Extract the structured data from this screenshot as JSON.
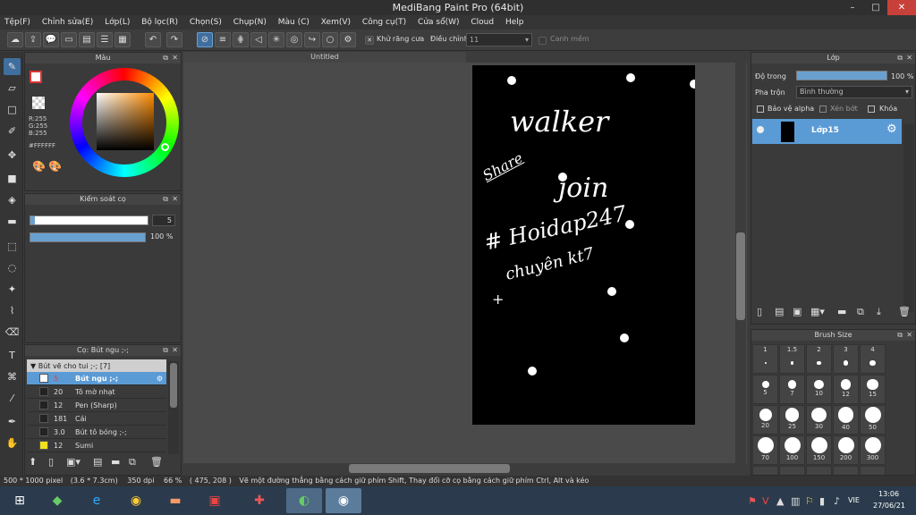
{
  "window": {
    "title": "MediBang Paint Pro (64bit)",
    "minimize": "–",
    "maximize": "□",
    "close": "✕"
  },
  "menu": [
    "Tệp(F)",
    "Chỉnh sửa(E)",
    "Lớp(L)",
    "Bộ lọc(R)",
    "Chọn(S)",
    "Chụp(N)",
    "Màu (C)",
    "Xem(V)",
    "Công cụ(T)",
    "Cửa sổ(W)",
    "Cloud",
    "Help"
  ],
  "toolbar": {
    "antialias_label": "Khử răng cưa",
    "adjust_label": "Điều chỉnh",
    "adjust_value": "11",
    "smooth_label": "Canh mềm"
  },
  "doc_tab": "Untitled",
  "color_panel": {
    "title": "Màu",
    "r": "R:255",
    "g": "G:255",
    "b": "B:255",
    "hex": "#FFFFFF"
  },
  "brush_control": {
    "title": "Kiểm soát cọ",
    "size": "5",
    "opacity": "100 %",
    "opacity_level": 1.0
  },
  "brush_list": {
    "title": "Cọ: Bút ngu ;-;",
    "group": "Bút vẽ cho tui ;-; [7]",
    "items": [
      {
        "size": "5",
        "name": "Bút ngu ;-;",
        "selected": true,
        "swatch": "#ffffff"
      },
      {
        "size": "20",
        "name": "Tô mờ nhạt",
        "selected": false,
        "swatch": "#222222"
      },
      {
        "size": "12",
        "name": "Pen (Sharp)",
        "selected": false,
        "swatch": "#222222"
      },
      {
        "size": "181",
        "name": "Cái",
        "selected": false,
        "swatch": "#222222"
      },
      {
        "size": "3.0",
        "name": "Bút tô bóng ;-;",
        "selected": false,
        "swatch": "#222222"
      },
      {
        "size": "12",
        "name": "Sumi",
        "selected": false,
        "swatch": "#f0e020"
      }
    ]
  },
  "layer_panel": {
    "title": "Lớp",
    "opacity_label": "Độ trong",
    "opacity_value": "100 %",
    "opacity_level": 1.0,
    "blend_label": "Pha trộn",
    "blend_value": "Bình thường",
    "protect_alpha": "Bảo vệ alpha",
    "clip": "Xén bớt",
    "lock": "Khóa",
    "layer_name": "Lớp15"
  },
  "brush_size_panel": {
    "title": "Brush Size",
    "rows": [
      [
        "1",
        "1.5",
        "2",
        "3",
        "4"
      ],
      [
        "5",
        "7",
        "10",
        "12",
        "15"
      ],
      [
        "20",
        "25",
        "30",
        "40",
        "50"
      ],
      [
        "70",
        "100",
        "150",
        "200",
        "300"
      ]
    ]
  },
  "artwork_text": {
    "line1": "walker",
    "line2": "Share",
    "line3": "join",
    "line4": "# Hoidap247",
    "line5": "chuyên kt7",
    "line6": "+"
  },
  "status": {
    "size": "500 * 1000 pixel",
    "cm": "(3.6 * 7.3cm)",
    "dpi": "350 dpi",
    "zoom": "66 %",
    "coords": "( 475, 208 )",
    "hint": "Vẽ một đường thẳng bằng cách giữ phím Shift, Thay đổi cỡ cọ bằng cách giữ phím Ctrl, Alt và kéo"
  },
  "taskbar": {
    "lang": "VIE",
    "time": "13:06",
    "date": "27/06/21"
  }
}
